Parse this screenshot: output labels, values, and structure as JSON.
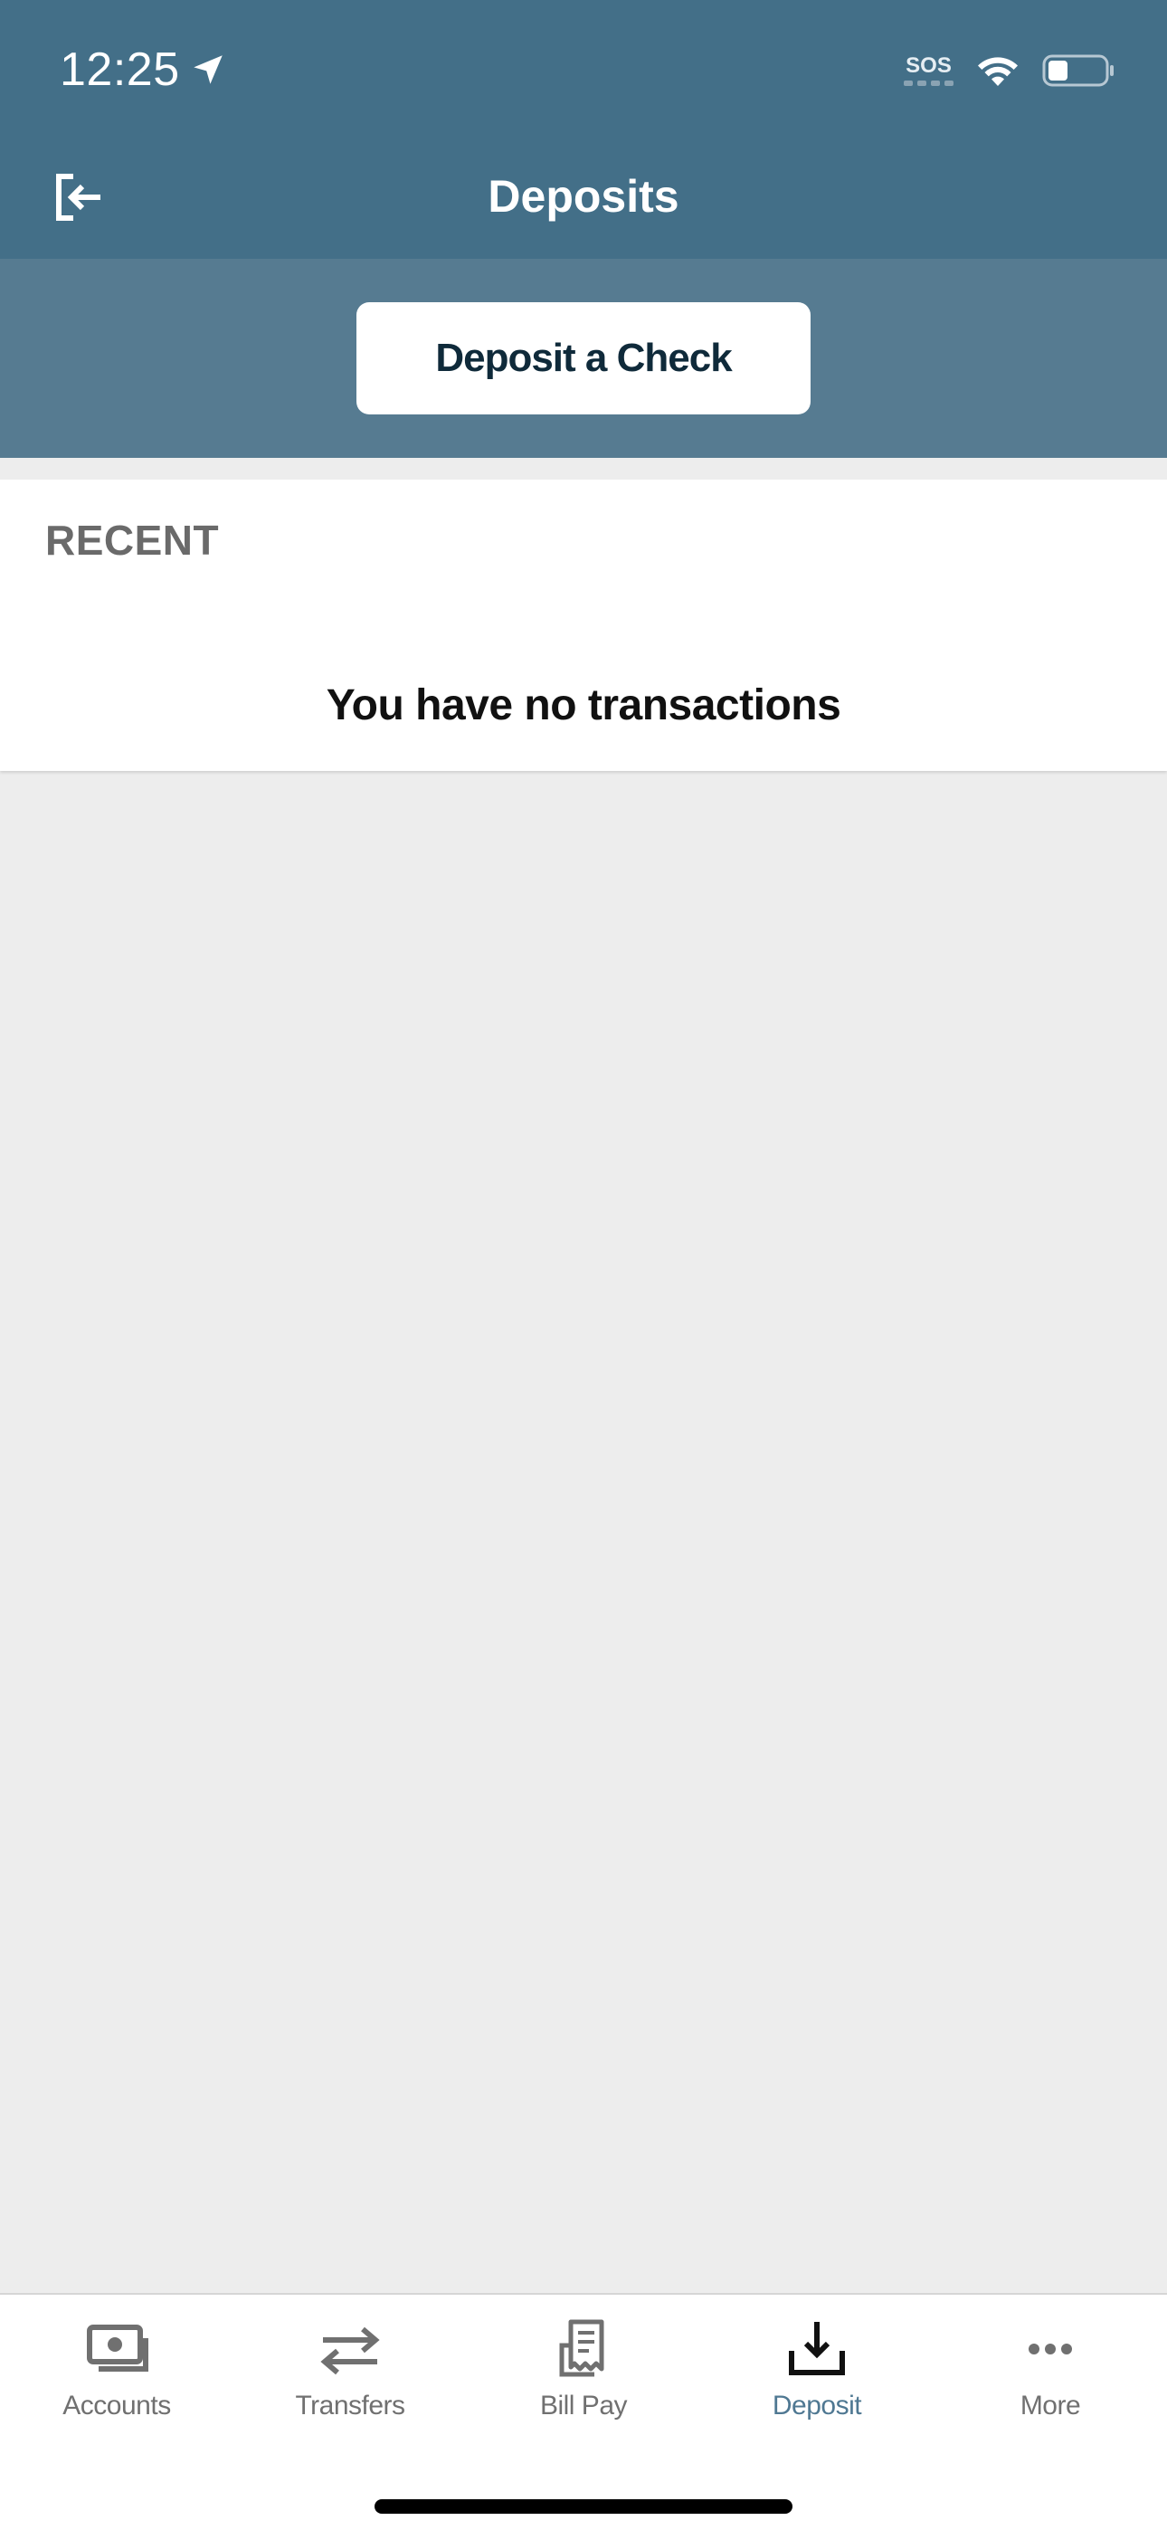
{
  "status_bar": {
    "time": "12:25",
    "location_icon": "location-arrow-icon",
    "sos": "SOS",
    "wifi_icon": "wifi-icon",
    "battery_icon": "battery-icon",
    "battery_level": 0.35
  },
  "header": {
    "title": "Deposits",
    "exit_icon": "sign-out-icon"
  },
  "actions": {
    "deposit_check_label": "Deposit a Check"
  },
  "recent": {
    "heading": "RECENT",
    "empty_message": "You have no transactions"
  },
  "tab_bar": {
    "tabs": [
      {
        "label": "Accounts",
        "icon": "accounts-icon",
        "active": false
      },
      {
        "label": "Transfers",
        "icon": "transfers-icon",
        "active": false
      },
      {
        "label": "Bill Pay",
        "icon": "bill-pay-icon",
        "active": false
      },
      {
        "label": "Deposit",
        "icon": "deposit-icon",
        "active": true
      },
      {
        "label": "More",
        "icon": "more-icon",
        "active": false
      }
    ]
  },
  "colors": {
    "header_background": "#436f88",
    "action_band_background": "#567b91",
    "page_background": "#ededed",
    "active_tab": "#4f7892",
    "inactive_tab": "#707070",
    "button_text": "#0f2a3a"
  }
}
